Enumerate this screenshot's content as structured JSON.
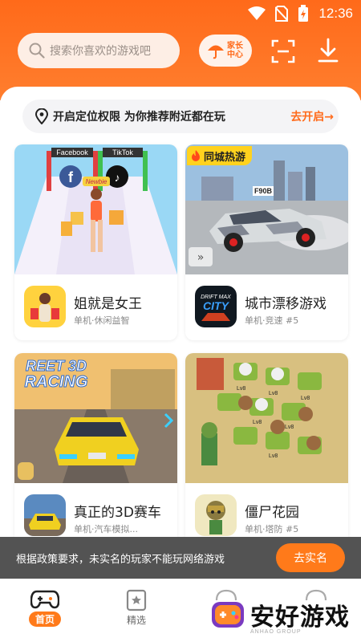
{
  "status": {
    "time": "12:36"
  },
  "header": {
    "search_placeholder": "搜索你喜欢的游戏吧",
    "parent_center_label": "家长中心",
    "accent": "#ff6a1a"
  },
  "location": {
    "text": "开启定位权限 为你推荐附近都在玩",
    "action": "去开启→"
  },
  "cards": [
    {
      "title": "姐就是女王",
      "sub": "单机·休闲益智",
      "badge": "",
      "art_text": [
        "Facebook",
        "TikTok",
        "Newbie"
      ]
    },
    {
      "title": "城市漂移游戏",
      "sub": "单机·竞速 #5",
      "badge": "同城热游",
      "art_text": [
        "F90B"
      ],
      "icon_text": [
        "DRIFT MAX",
        "CITY"
      ]
    },
    {
      "title": "真正的3D赛车",
      "sub": "单机·汽车模拟...",
      "badge": "",
      "art_text": [
        "REET 3D",
        "RACING"
      ]
    },
    {
      "title": "僵尸花园",
      "sub": "单机·塔防 #5",
      "badge": "",
      "art_text": [
        "Lv8",
        "Lv8",
        "Lv8",
        "Lv8",
        "Lv8",
        "Lv8"
      ]
    }
  ],
  "toast": {
    "text": "根据政策要求，未实名的玩家不能玩网络游戏",
    "button": "去实名"
  },
  "nav": {
    "home": "首页",
    "featured": "精选"
  },
  "watermark": {
    "text": "安好游戏",
    "sub": "ANHAO GROUP"
  }
}
